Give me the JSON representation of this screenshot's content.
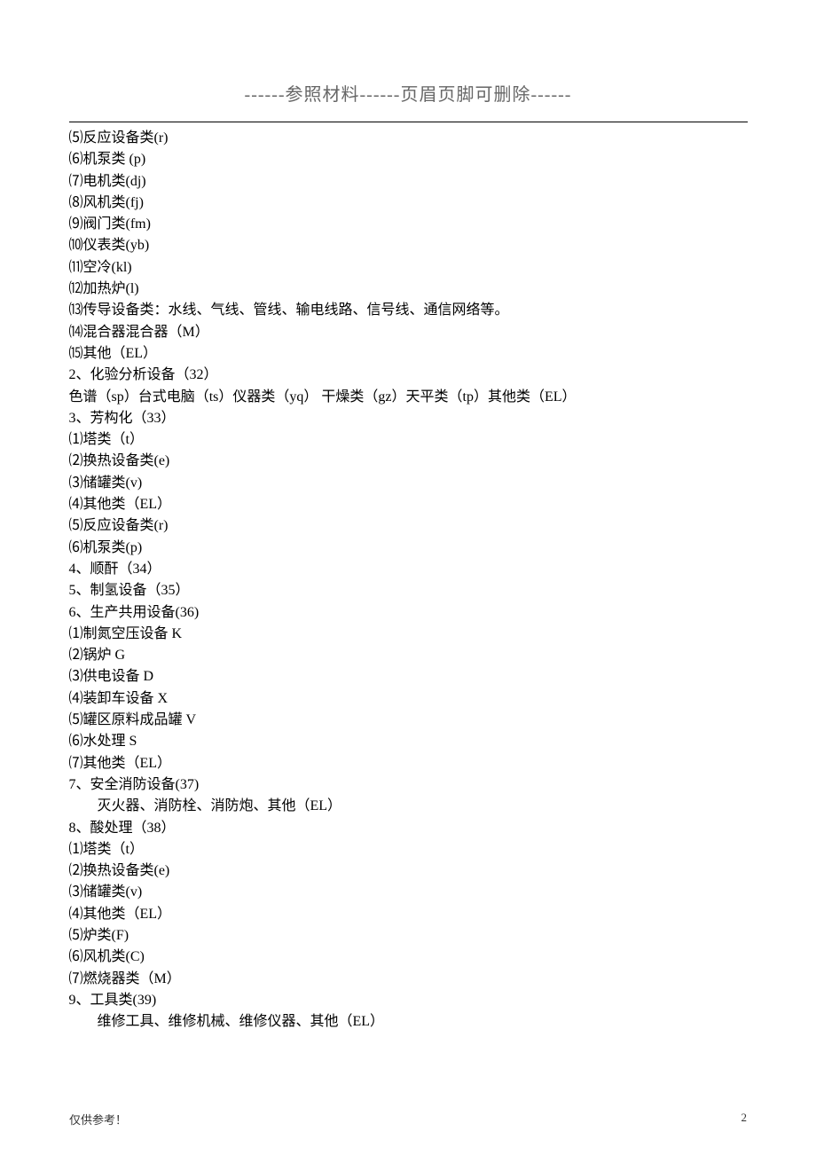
{
  "header": {
    "text": "------参照材料------页眉页脚可删除------"
  },
  "lines": [
    {
      "text": "⑸反应设备类(r)",
      "indent": false
    },
    {
      "text": "⑹机泵类 (p)",
      "indent": false
    },
    {
      "text": "⑺电机类(dj)",
      "indent": false
    },
    {
      "text": "⑻风机类(fj)",
      "indent": false
    },
    {
      "text": "⑼阀门类(fm)",
      "indent": false
    },
    {
      "text": "⑽仪表类(yb)",
      "indent": false
    },
    {
      "text": "⑾空冷(kl)",
      "indent": false
    },
    {
      "text": "⑿加热炉(l)",
      "indent": false
    },
    {
      "text": "⒀传导设备类：水线、气线、管线、输电线路、信号线、通信网络等。",
      "indent": false
    },
    {
      "text": "⒁混合器混合器（M）",
      "indent": false
    },
    {
      "text": "⒂其他（EL）",
      "indent": false
    },
    {
      "text": "2、化验分析设备（32）",
      "indent": false
    },
    {
      "text": "色谱（sp）台式电脑（ts）仪器类（yq） 干燥类（gz）天平类（tp）其他类（EL）",
      "indent": false
    },
    {
      "text": "3、芳构化（33）",
      "indent": false
    },
    {
      "text": "⑴塔类（t）",
      "indent": false
    },
    {
      "text": "⑵换热设备类(e)",
      "indent": false
    },
    {
      "text": "⑶储罐类(v)",
      "indent": false
    },
    {
      "text": "⑷其他类（EL）",
      "indent": false
    },
    {
      "text": "⑸反应设备类(r)",
      "indent": false
    },
    {
      "text": "⑹机泵类(p)",
      "indent": false
    },
    {
      "text": "4、顺酐（34）",
      "indent": false
    },
    {
      "text": "5、制氢设备（35）",
      "indent": false
    },
    {
      "text": "6、生产共用设备(36)",
      "indent": false
    },
    {
      "text": "⑴制氮空压设备 K",
      "indent": false
    },
    {
      "text": "⑵锅炉 G",
      "indent": false
    },
    {
      "text": "⑶供电设备 D",
      "indent": false
    },
    {
      "text": "⑷装卸车设备 X",
      "indent": false
    },
    {
      "text": "⑸罐区原料成品罐 V",
      "indent": false
    },
    {
      "text": "⑹水处理 S",
      "indent": false
    },
    {
      "text": "⑺其他类（EL）",
      "indent": false
    },
    {
      "text": "7、安全消防设备(37)",
      "indent": false
    },
    {
      "text": "灭火器、消防栓、消防炮、其他（EL）",
      "indent": true
    },
    {
      "text": "8、酸处理（38）",
      "indent": false
    },
    {
      "text": "⑴塔类（t）",
      "indent": false
    },
    {
      "text": "⑵换热设备类(e)",
      "indent": false
    },
    {
      "text": "⑶储罐类(v)",
      "indent": false
    },
    {
      "text": "⑷其他类（EL）",
      "indent": false
    },
    {
      "text": "⑸炉类(F)",
      "indent": false
    },
    {
      "text": "⑹风机类(C)",
      "indent": false
    },
    {
      "text": "⑺燃烧器类（M）",
      "indent": false
    },
    {
      "text": "9、工具类(39)",
      "indent": false
    },
    {
      "text": "维修工具、维修机械、维修仪器、其他（EL）",
      "indent": true
    }
  ],
  "footer": {
    "left": "仅供参考！",
    "right": "2"
  }
}
